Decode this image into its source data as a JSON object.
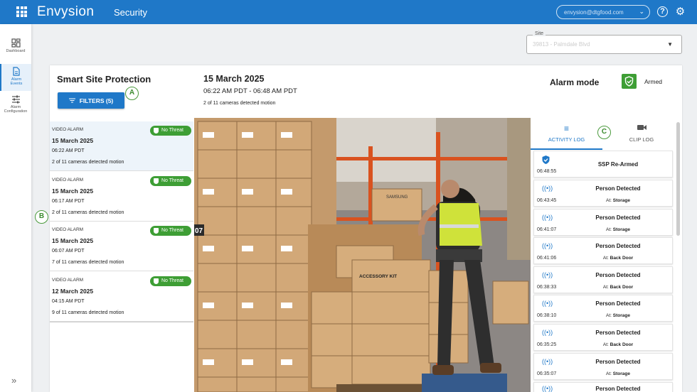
{
  "header": {
    "logo": "Envysion",
    "app": "Security",
    "account": "envysion@dtgfood.com",
    "help_icon": "help-icon",
    "settings_icon": "gear-icon"
  },
  "sidenav": {
    "items": [
      {
        "label": "Dashboard",
        "icon": "dashboard-icon"
      },
      {
        "label": "Alarm Events",
        "icon": "document-icon",
        "active": true
      },
      {
        "label": "Alarm Configuration",
        "icon": "sliders-icon"
      }
    ],
    "collapse": "»"
  },
  "site": {
    "label": "Site",
    "value": "39813 - Palmdale Blvd"
  },
  "ssp": {
    "title": "Smart Site Protection",
    "filters": "FILTERS (5)"
  },
  "event": {
    "date": "15 March 2025",
    "time_range": "06:22 AM PDT - 06:48 AM PDT",
    "cameras": "2 of 11 cameras detected motion"
  },
  "alarm": {
    "label": "Alarm mode",
    "status": "Armed"
  },
  "callouts": {
    "a": "A",
    "b": "B",
    "c": "C"
  },
  "alarms": [
    {
      "type": "VIDEO ALARM",
      "date": "15 March 2025",
      "time": "06:22 AM PDT",
      "cameras": "2 of 11 cameras detected motion",
      "badge": "No Threat"
    },
    {
      "type": "VIDEO ALARM",
      "date": "15 March 2025",
      "time": "06:17 AM PDT",
      "cameras": "2 of 11 cameras detected motion",
      "badge": "No Threat"
    },
    {
      "type": "VIDEO ALARM",
      "date": "15 March 2025",
      "time": "06:07 AM PDT",
      "cameras": "7 of 11 cameras detected motion",
      "badge": "No Threat"
    },
    {
      "type": "VIDEO ALARM",
      "date": "12 March 2025",
      "time": "04:15 AM PDT",
      "cameras": "9 of 11 cameras detected motion",
      "badge": "No Threat"
    }
  ],
  "tabs": {
    "activity": "ACTIVITY LOG",
    "clip": "CLIP LOG"
  },
  "log": [
    {
      "title": "SSP Re-Armed",
      "time": "06:48:55",
      "at_label": "",
      "location": "",
      "icon": "shield-check-icon"
    },
    {
      "title": "Person Detected",
      "time": "06:43:45",
      "at_label": "At:",
      "location": "Storage",
      "icon": "broadcast-icon"
    },
    {
      "title": "Person Detected",
      "time": "06:41:07",
      "at_label": "At:",
      "location": "Storage",
      "icon": "broadcast-icon"
    },
    {
      "title": "Person Detected",
      "time": "06:41:06",
      "at_label": "At:",
      "location": "Back Door",
      "icon": "broadcast-icon"
    },
    {
      "title": "Person Detected",
      "time": "06:38:33",
      "at_label": "At:",
      "location": "Back Door",
      "icon": "broadcast-icon"
    },
    {
      "title": "Person Detected",
      "time": "06:38:10",
      "at_label": "At:",
      "location": "Storage",
      "icon": "broadcast-icon"
    },
    {
      "title": "Person Detected",
      "time": "06:35:25",
      "at_label": "At:",
      "location": "Back Door",
      "icon": "broadcast-icon"
    },
    {
      "title": "Person Detected",
      "time": "06:35:07",
      "at_label": "At:",
      "location": "Storage",
      "icon": "broadcast-icon"
    },
    {
      "title": "Person Detected",
      "time": "",
      "at_label": "",
      "location": "",
      "icon": "broadcast-icon"
    }
  ],
  "video": {
    "shelf_label": "07",
    "label": "SAMSUNG",
    "kit": "ACCESSORY KIT"
  }
}
